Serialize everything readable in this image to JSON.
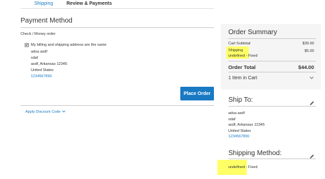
{
  "steps": {
    "shipping": "Shipping",
    "review": "Review & Payments"
  },
  "payment": {
    "title": "Payment Method",
    "method_label": "Check / Money order",
    "same_address_label": "My billing and shipping address are the same",
    "address": [
      "adsa asdf",
      "sdaf",
      "asdf, Arkansas 12345",
      "United States"
    ],
    "phone": "1234567890",
    "place_order_label": "Place Order",
    "discount_label": "Apply Discount Code",
    "same_address_checked": true
  },
  "summary": {
    "title": "Order Summary",
    "cart_subtotal_label": "Cart Subtotal",
    "cart_subtotal_value": "$39.00",
    "shipping_label": "Shipping",
    "shipping_method": "undefined - Fixed",
    "shipping_value": "$5.00",
    "total_label": "Order Total",
    "total_value": "$44.00",
    "items_in_cart": "1 Item in Cart"
  },
  "ship_to": {
    "title": "Ship To:",
    "address": [
      "adsa asdf",
      "sdaf",
      "asdf, Arkansas 12345",
      "United States"
    ],
    "phone": "1234567890"
  },
  "shipping_method": {
    "title": "Shipping Method:",
    "value": "undefined - Fixed"
  },
  "colors": {
    "link": "#1979c3",
    "highlight": "#ffff66",
    "summary_bg": "#f5f5f5"
  }
}
